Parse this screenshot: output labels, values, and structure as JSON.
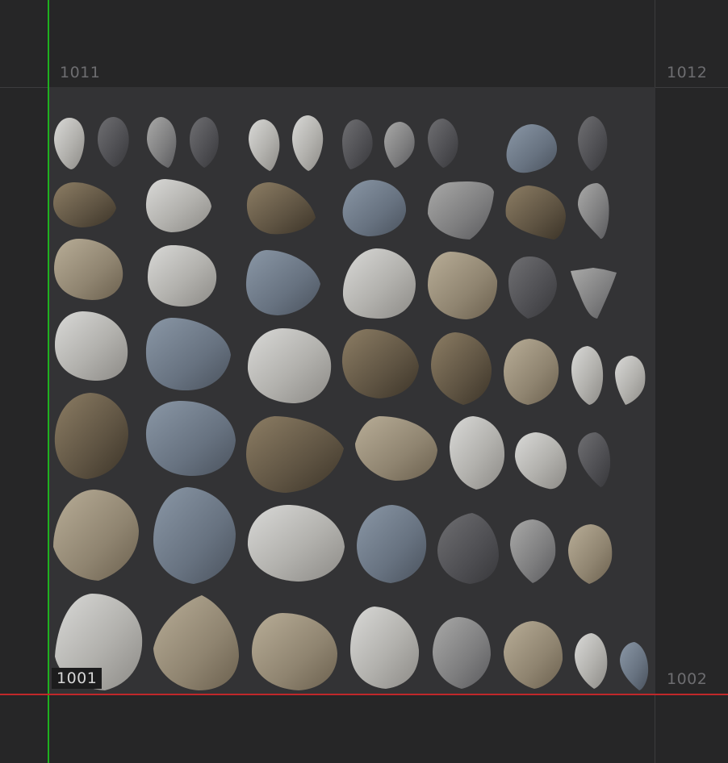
{
  "viewport": {
    "tiles": {
      "tile_1011": "1011",
      "tile_1012": "1012",
      "tile_1001": "1001",
      "tile_1002": "1002"
    },
    "colors": {
      "background": "#262627",
      "active_tile": "#333335",
      "grid_line": "#3c3c3e",
      "v_axis": "#1fb01f",
      "u_axis": "#c0282a"
    },
    "shell_count": 53
  }
}
